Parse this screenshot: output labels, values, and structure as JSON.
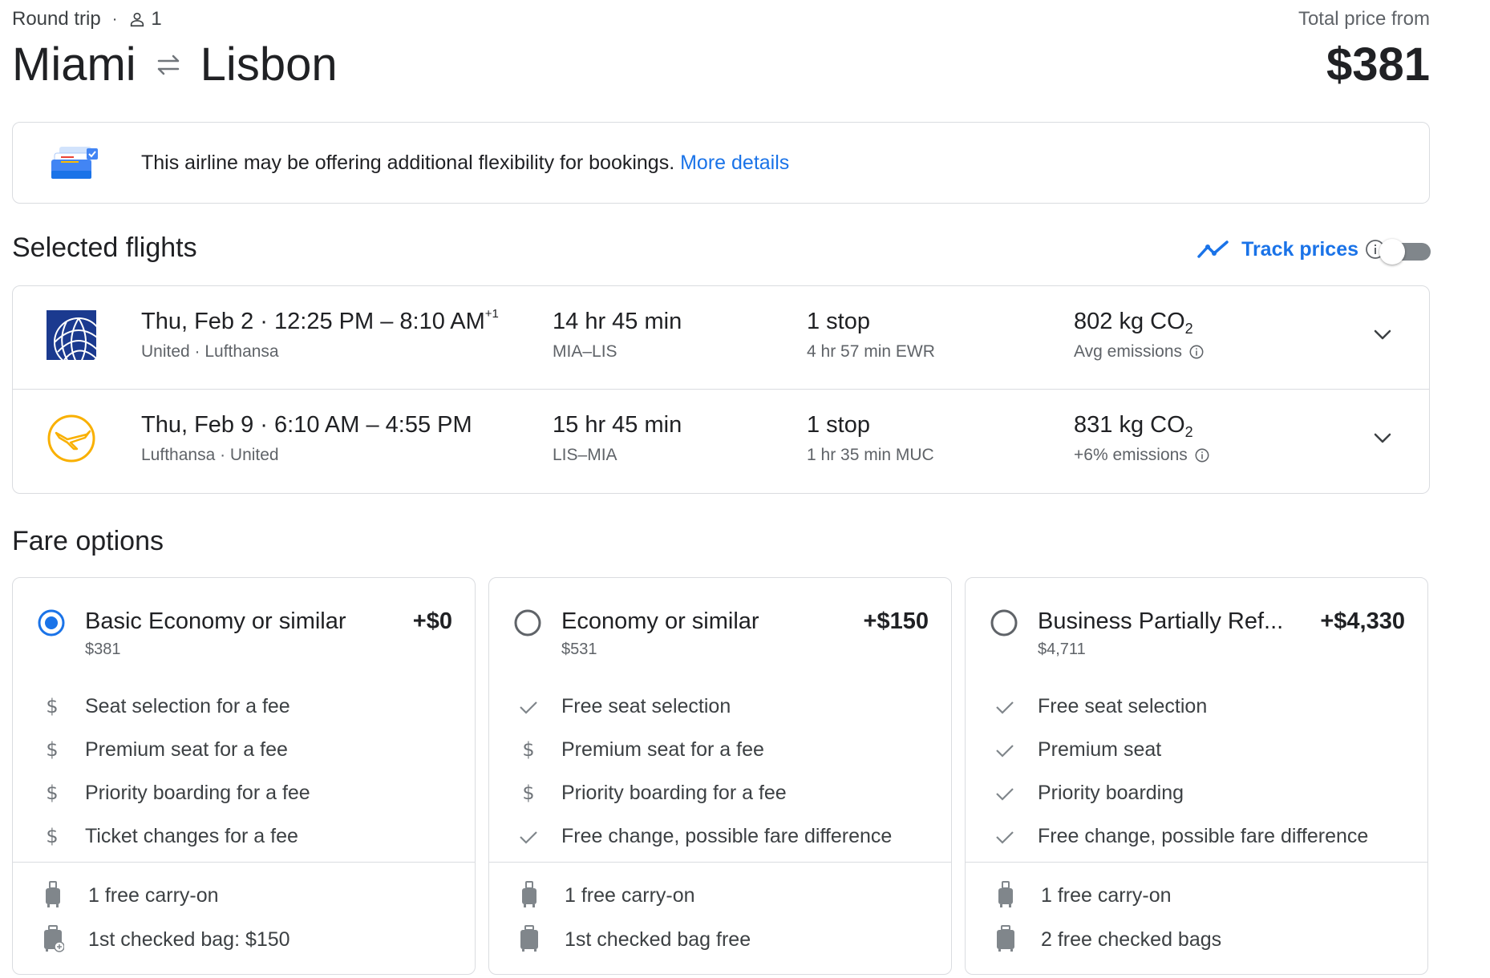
{
  "header": {
    "trip_type": "Round trip",
    "separator": "·",
    "passengers": "1",
    "origin": "Miami",
    "destination": "Lisbon",
    "price_label": "Total price from",
    "price_total": "$381"
  },
  "notice": {
    "text": "This airline may be offering additional flexibility for bookings. ",
    "link": "More details"
  },
  "selected_flights": {
    "title": "Selected flights",
    "track_prices_label": "Track prices",
    "track_prices_on": false,
    "flights": [
      {
        "logo": "united-logo-icon",
        "times": "Thu, Feb 2  ·  12:25 PM – 8:10 AM",
        "day_offset": "+1",
        "airlines": "United · Lufthansa",
        "duration": "14 hr 45 min",
        "route": "MIA–LIS",
        "stops": "1 stop",
        "layover": "4 hr 57 min EWR",
        "emissions": "802 kg CO",
        "emissions_sub": "2",
        "emissions_note": "Avg emissions"
      },
      {
        "logo": "lufthansa-logo-icon",
        "times": "Thu, Feb 9  ·  6:10 AM – 4:55 PM",
        "day_offset": "",
        "airlines": "Lufthansa · United",
        "duration": "15 hr 45 min",
        "route": "LIS–MIA",
        "stops": "1 stop",
        "layover": "1 hr 35 min MUC",
        "emissions": "831 kg CO",
        "emissions_sub": "2",
        "emissions_note": "+6% emissions"
      }
    ]
  },
  "fare_options": {
    "title": "Fare options",
    "cards": [
      {
        "name_bold": "Basic Economy",
        "name_rest": " or similar",
        "add_price": "+$0",
        "price": "$381",
        "selected": true,
        "features": [
          {
            "icon": "dollar-icon",
            "text": "Seat selection for a fee"
          },
          {
            "icon": "dollar-icon",
            "text": "Premium seat for a fee"
          },
          {
            "icon": "dollar-icon",
            "text": "Priority boarding for a fee"
          },
          {
            "icon": "dollar-icon",
            "text": "Ticket changes for a fee"
          }
        ],
        "bags": [
          {
            "icon": "carry-on-icon",
            "text": "1 free carry-on"
          },
          {
            "icon": "checked-bag-fee-icon",
            "text": "1st checked bag: $150"
          }
        ]
      },
      {
        "name_bold": "Economy",
        "name_rest": " or similar",
        "add_price": "+$150",
        "price": "$531",
        "selected": false,
        "features": [
          {
            "icon": "check-icon",
            "text": "Free seat selection"
          },
          {
            "icon": "dollar-icon",
            "text": "Premium seat for a fee"
          },
          {
            "icon": "dollar-icon",
            "text": "Priority boarding for a fee"
          },
          {
            "icon": "check-icon",
            "text": "Free change, possible fare difference"
          }
        ],
        "bags": [
          {
            "icon": "carry-on-icon",
            "text": "1 free carry-on"
          },
          {
            "icon": "checked-bag-icon",
            "text": "1st checked bag free"
          }
        ]
      },
      {
        "name_bold": "Business Partially Ref...",
        "name_rest": "",
        "add_price": "+$4,330",
        "price": "$4,711",
        "selected": false,
        "features": [
          {
            "icon": "check-icon",
            "text": "Free seat selection"
          },
          {
            "icon": "check-icon",
            "text": "Premium seat"
          },
          {
            "icon": "check-icon",
            "text": "Priority boarding"
          },
          {
            "icon": "check-icon",
            "text": "Free change, possible fare difference"
          }
        ],
        "bags": [
          {
            "icon": "carry-on-icon",
            "text": "1 free carry-on"
          },
          {
            "icon": "checked-bag-icon",
            "text": "2 free checked bags"
          }
        ]
      }
    ]
  },
  "colors": {
    "accent": "#1a73e8",
    "text": "#202124",
    "muted": "#5f6368",
    "border": "#dadce0",
    "lufthansa_yellow": "#f9b000",
    "united_blue": "#1b3a8f"
  }
}
